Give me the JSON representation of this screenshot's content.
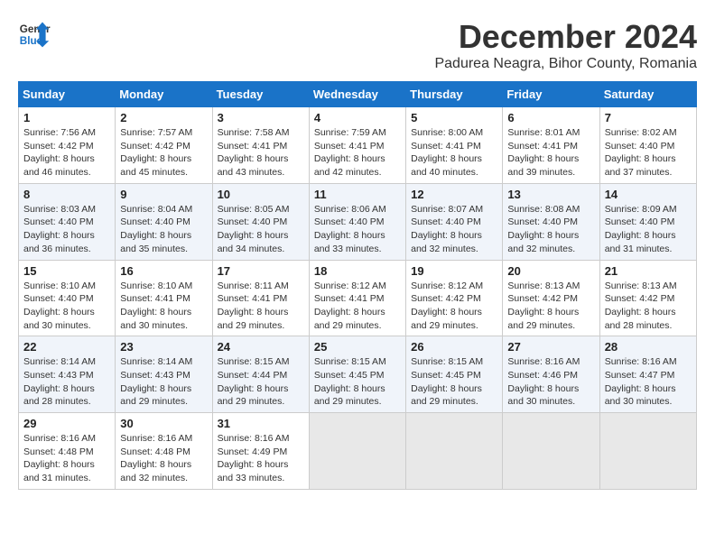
{
  "header": {
    "logo": {
      "line1": "General",
      "line2": "Blue"
    },
    "title": "December 2024",
    "subtitle": "Padurea Neagra, Bihor County, Romania"
  },
  "calendar": {
    "headers": [
      "Sunday",
      "Monday",
      "Tuesday",
      "Wednesday",
      "Thursday",
      "Friday",
      "Saturday"
    ],
    "weeks": [
      [
        {
          "day": "1",
          "info": "Sunrise: 7:56 AM\nSunset: 4:42 PM\nDaylight: 8 hours\nand 46 minutes."
        },
        {
          "day": "2",
          "info": "Sunrise: 7:57 AM\nSunset: 4:42 PM\nDaylight: 8 hours\nand 45 minutes."
        },
        {
          "day": "3",
          "info": "Sunrise: 7:58 AM\nSunset: 4:41 PM\nDaylight: 8 hours\nand 43 minutes."
        },
        {
          "day": "4",
          "info": "Sunrise: 7:59 AM\nSunset: 4:41 PM\nDaylight: 8 hours\nand 42 minutes."
        },
        {
          "day": "5",
          "info": "Sunrise: 8:00 AM\nSunset: 4:41 PM\nDaylight: 8 hours\nand 40 minutes."
        },
        {
          "day": "6",
          "info": "Sunrise: 8:01 AM\nSunset: 4:41 PM\nDaylight: 8 hours\nand 39 minutes."
        },
        {
          "day": "7",
          "info": "Sunrise: 8:02 AM\nSunset: 4:40 PM\nDaylight: 8 hours\nand 37 minutes."
        }
      ],
      [
        {
          "day": "8",
          "info": "Sunrise: 8:03 AM\nSunset: 4:40 PM\nDaylight: 8 hours\nand 36 minutes."
        },
        {
          "day": "9",
          "info": "Sunrise: 8:04 AM\nSunset: 4:40 PM\nDaylight: 8 hours\nand 35 minutes."
        },
        {
          "day": "10",
          "info": "Sunrise: 8:05 AM\nSunset: 4:40 PM\nDaylight: 8 hours\nand 34 minutes."
        },
        {
          "day": "11",
          "info": "Sunrise: 8:06 AM\nSunset: 4:40 PM\nDaylight: 8 hours\nand 33 minutes."
        },
        {
          "day": "12",
          "info": "Sunrise: 8:07 AM\nSunset: 4:40 PM\nDaylight: 8 hours\nand 32 minutes."
        },
        {
          "day": "13",
          "info": "Sunrise: 8:08 AM\nSunset: 4:40 PM\nDaylight: 8 hours\nand 32 minutes."
        },
        {
          "day": "14",
          "info": "Sunrise: 8:09 AM\nSunset: 4:40 PM\nDaylight: 8 hours\nand 31 minutes."
        }
      ],
      [
        {
          "day": "15",
          "info": "Sunrise: 8:10 AM\nSunset: 4:40 PM\nDaylight: 8 hours\nand 30 minutes."
        },
        {
          "day": "16",
          "info": "Sunrise: 8:10 AM\nSunset: 4:41 PM\nDaylight: 8 hours\nand 30 minutes."
        },
        {
          "day": "17",
          "info": "Sunrise: 8:11 AM\nSunset: 4:41 PM\nDaylight: 8 hours\nand 29 minutes."
        },
        {
          "day": "18",
          "info": "Sunrise: 8:12 AM\nSunset: 4:41 PM\nDaylight: 8 hours\nand 29 minutes."
        },
        {
          "day": "19",
          "info": "Sunrise: 8:12 AM\nSunset: 4:42 PM\nDaylight: 8 hours\nand 29 minutes."
        },
        {
          "day": "20",
          "info": "Sunrise: 8:13 AM\nSunset: 4:42 PM\nDaylight: 8 hours\nand 29 minutes."
        },
        {
          "day": "21",
          "info": "Sunrise: 8:13 AM\nSunset: 4:42 PM\nDaylight: 8 hours\nand 28 minutes."
        }
      ],
      [
        {
          "day": "22",
          "info": "Sunrise: 8:14 AM\nSunset: 4:43 PM\nDaylight: 8 hours\nand 28 minutes."
        },
        {
          "day": "23",
          "info": "Sunrise: 8:14 AM\nSunset: 4:43 PM\nDaylight: 8 hours\nand 29 minutes."
        },
        {
          "day": "24",
          "info": "Sunrise: 8:15 AM\nSunset: 4:44 PM\nDaylight: 8 hours\nand 29 minutes."
        },
        {
          "day": "25",
          "info": "Sunrise: 8:15 AM\nSunset: 4:45 PM\nDaylight: 8 hours\nand 29 minutes."
        },
        {
          "day": "26",
          "info": "Sunrise: 8:15 AM\nSunset: 4:45 PM\nDaylight: 8 hours\nand 29 minutes."
        },
        {
          "day": "27",
          "info": "Sunrise: 8:16 AM\nSunset: 4:46 PM\nDaylight: 8 hours\nand 30 minutes."
        },
        {
          "day": "28",
          "info": "Sunrise: 8:16 AM\nSunset: 4:47 PM\nDaylight: 8 hours\nand 30 minutes."
        }
      ],
      [
        {
          "day": "29",
          "info": "Sunrise: 8:16 AM\nSunset: 4:48 PM\nDaylight: 8 hours\nand 31 minutes."
        },
        {
          "day": "30",
          "info": "Sunrise: 8:16 AM\nSunset: 4:48 PM\nDaylight: 8 hours\nand 32 minutes."
        },
        {
          "day": "31",
          "info": "Sunrise: 8:16 AM\nSunset: 4:49 PM\nDaylight: 8 hours\nand 33 minutes."
        },
        {
          "day": "",
          "info": ""
        },
        {
          "day": "",
          "info": ""
        },
        {
          "day": "",
          "info": ""
        },
        {
          "day": "",
          "info": ""
        }
      ]
    ]
  }
}
